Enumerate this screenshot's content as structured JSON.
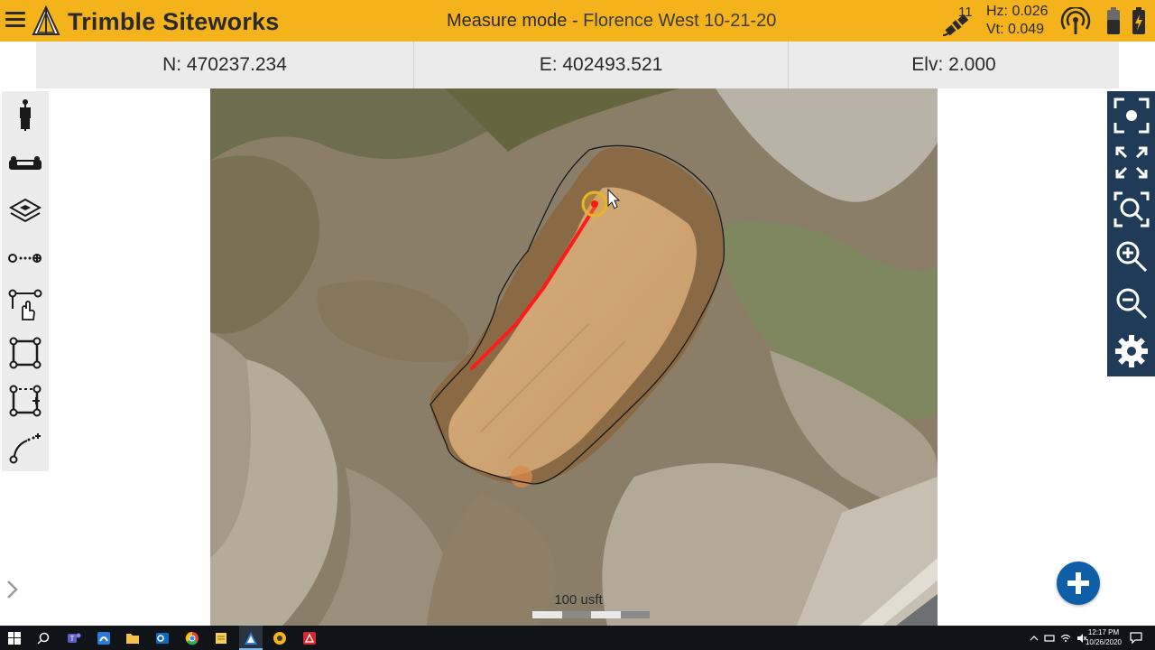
{
  "header": {
    "app_title": "Trimble Siteworks",
    "mode_label": "Measure mode - ",
    "project_name": "Florence West 10-21-20",
    "satellites": "11",
    "hz_precision": "Hz: 0.026",
    "vt_precision": "Vt: 0.049"
  },
  "coordinates": {
    "north": "N: 470237.234",
    "east": "E: 402493.521",
    "elevation": "Elv: 2.000"
  },
  "left_toolbar": {
    "items": [
      "rover-pole",
      "laser-instrument",
      "layers",
      "measure-line",
      "select-tap",
      "boundary-square",
      "boundary-open",
      "curve-points"
    ]
  },
  "right_toolbar": {
    "items": [
      "zoom-extents",
      "fit-view",
      "zoom-window",
      "zoom-in",
      "zoom-out",
      "settings"
    ]
  },
  "map": {
    "scale_label": "100 usft",
    "selection_color": "#ff1a1a",
    "boundary_color": "#1a1a1a"
  },
  "taskbar": {
    "time": "12:17 PM",
    "date": "10/26/2020",
    "apps": [
      "start",
      "search",
      "teams",
      "siteworks-app",
      "file-explorer",
      "outlook",
      "chrome",
      "notepad",
      "trimble-siteworks",
      "sketch",
      "acrobat"
    ]
  },
  "colors": {
    "header_bg": "#f5b31b",
    "right_toolbar_bg": "#1f3b57",
    "fab_bg": "#0f5ea8"
  }
}
